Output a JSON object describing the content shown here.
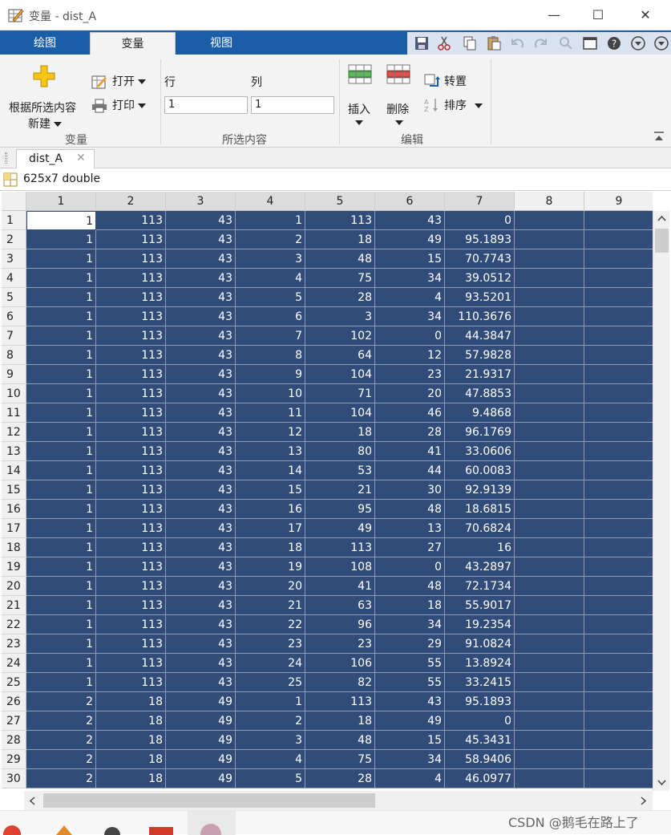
{
  "window": {
    "title": "变量 - dist_A",
    "controls": [
      "—",
      "☐",
      "✕"
    ]
  },
  "ribbon_tabs": [
    {
      "label": "绘图",
      "active": false
    },
    {
      "label": "变量",
      "active": true
    },
    {
      "label": "视图",
      "active": false
    }
  ],
  "ribbon": {
    "new_from_selection_line1": "根据所选内容",
    "new_from_selection_line2": "新建",
    "open_label": "打开",
    "print_label": "打印",
    "group_variable": "变量",
    "row_label": "行",
    "col_label": "列",
    "row_value": "1",
    "col_value": "1",
    "group_selection": "所选内容",
    "insert_label": "插入",
    "delete_label": "删除",
    "transpose_label": "转置",
    "sort_label": "排序",
    "group_edit": "编辑"
  },
  "doc_tab": {
    "label": "dist_A",
    "close": "✕"
  },
  "variable_info": "625x7 double",
  "table": {
    "column_headers": [
      "1",
      "2",
      "3",
      "4",
      "5",
      "6",
      "7",
      "8",
      "9"
    ],
    "rows": [
      [
        "1",
        "1",
        "113",
        "43",
        "1",
        "113",
        "43",
        "0"
      ],
      [
        "2",
        "1",
        "113",
        "43",
        "2",
        "18",
        "49",
        "95.1893"
      ],
      [
        "3",
        "1",
        "113",
        "43",
        "3",
        "48",
        "15",
        "70.7743"
      ],
      [
        "4",
        "1",
        "113",
        "43",
        "4",
        "75",
        "34",
        "39.0512"
      ],
      [
        "5",
        "1",
        "113",
        "43",
        "5",
        "28",
        "4",
        "93.5201"
      ],
      [
        "6",
        "1",
        "113",
        "43",
        "6",
        "3",
        "34",
        "110.3676"
      ],
      [
        "7",
        "1",
        "113",
        "43",
        "7",
        "102",
        "0",
        "44.3847"
      ],
      [
        "8",
        "1",
        "113",
        "43",
        "8",
        "64",
        "12",
        "57.9828"
      ],
      [
        "9",
        "1",
        "113",
        "43",
        "9",
        "104",
        "23",
        "21.9317"
      ],
      [
        "10",
        "1",
        "113",
        "43",
        "10",
        "71",
        "20",
        "47.8853"
      ],
      [
        "11",
        "1",
        "113",
        "43",
        "11",
        "104",
        "46",
        "9.4868"
      ],
      [
        "12",
        "1",
        "113",
        "43",
        "12",
        "18",
        "28",
        "96.1769"
      ],
      [
        "13",
        "1",
        "113",
        "43",
        "13",
        "80",
        "41",
        "33.0606"
      ],
      [
        "14",
        "1",
        "113",
        "43",
        "14",
        "53",
        "44",
        "60.0083"
      ],
      [
        "15",
        "1",
        "113",
        "43",
        "15",
        "21",
        "30",
        "92.9139"
      ],
      [
        "16",
        "1",
        "113",
        "43",
        "16",
        "95",
        "48",
        "18.6815"
      ],
      [
        "17",
        "1",
        "113",
        "43",
        "17",
        "49",
        "13",
        "70.6824"
      ],
      [
        "18",
        "1",
        "113",
        "43",
        "18",
        "113",
        "27",
        "16"
      ],
      [
        "19",
        "1",
        "113",
        "43",
        "19",
        "108",
        "0",
        "43.2897"
      ],
      [
        "20",
        "1",
        "113",
        "43",
        "20",
        "41",
        "48",
        "72.1734"
      ],
      [
        "21",
        "1",
        "113",
        "43",
        "21",
        "63",
        "18",
        "55.9017"
      ],
      [
        "22",
        "1",
        "113",
        "43",
        "22",
        "96",
        "34",
        "19.2354"
      ],
      [
        "23",
        "1",
        "113",
        "43",
        "23",
        "23",
        "29",
        "91.0824"
      ],
      [
        "24",
        "1",
        "113",
        "43",
        "24",
        "106",
        "55",
        "13.8924"
      ],
      [
        "25",
        "1",
        "113",
        "43",
        "25",
        "82",
        "55",
        "33.2415"
      ],
      [
        "26",
        "2",
        "18",
        "49",
        "1",
        "113",
        "43",
        "95.1893"
      ],
      [
        "27",
        "2",
        "18",
        "49",
        "2",
        "18",
        "49",
        "0"
      ],
      [
        "28",
        "2",
        "18",
        "49",
        "3",
        "48",
        "15",
        "45.3431"
      ],
      [
        "29",
        "2",
        "18",
        "49",
        "4",
        "75",
        "34",
        "58.9406"
      ],
      [
        "30",
        "2",
        "18",
        "49",
        "5",
        "28",
        "4",
        "46.0977"
      ]
    ]
  },
  "watermark": "CSDN @鹅毛在路上了",
  "colors": {
    "ribbon_blue": "#1a5ea8",
    "selection": "#324c7a"
  }
}
